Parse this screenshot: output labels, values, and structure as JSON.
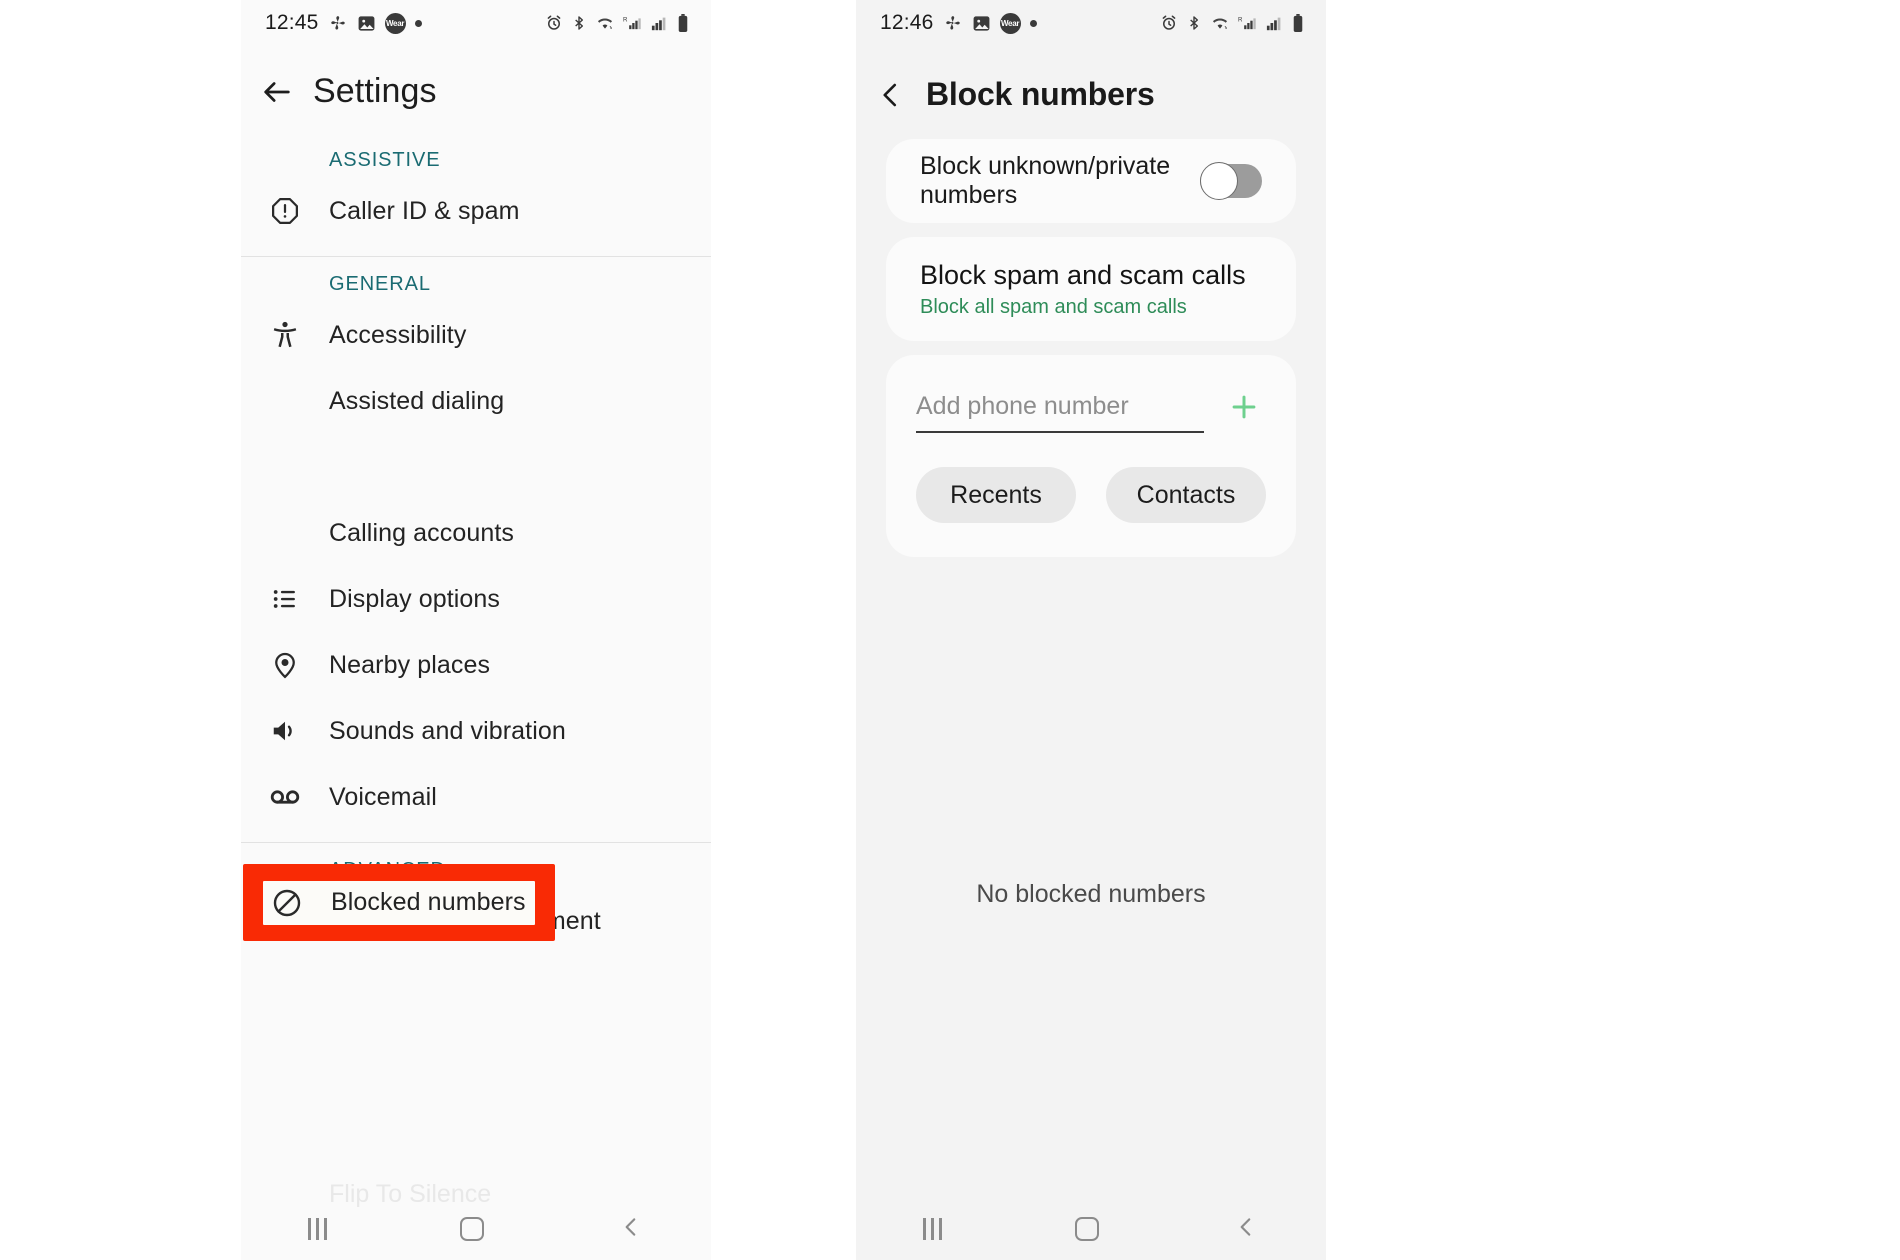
{
  "left_phone": {
    "status_bar": {
      "time": "12:45",
      "icons_left": [
        "fan-icon",
        "image-icon",
        "wear-icon",
        "dot-icon"
      ],
      "wear_label": "Wear",
      "icons_right": [
        "alarm-icon",
        "bluetooth-icon",
        "wifi-icon",
        "signal-r-icon",
        "signal-icon",
        "battery-icon"
      ],
      "signal_r_label": "R"
    },
    "app_bar": {
      "back_icon": "arrow-left-icon",
      "title": "Settings"
    },
    "sections": [
      {
        "label": "ASSISTIVE",
        "items": [
          {
            "icon": "exclamation-octagon-icon",
            "label": "Caller ID & spam"
          }
        ]
      },
      {
        "label": "GENERAL",
        "items": [
          {
            "icon": "accessibility-icon",
            "label": "Accessibility"
          },
          {
            "icon": "none",
            "label": "Assisted dialing"
          },
          {
            "icon": "block-icon",
            "label": "Blocked numbers",
            "highlighted": true
          },
          {
            "icon": "none",
            "label": "Calling accounts"
          },
          {
            "icon": "list-icon",
            "label": "Display options"
          },
          {
            "icon": "location-pin-icon",
            "label": "Nearby places"
          },
          {
            "icon": "speaker-icon",
            "label": "Sounds and vibration"
          },
          {
            "icon": "voicemail-icon",
            "label": "Voicemail"
          }
        ]
      },
      {
        "label": "ADVANCED",
        "items": [
          {
            "icon": "none",
            "label": "Caller ID announcement"
          }
        ]
      }
    ],
    "faded_item": "Flip To Silence",
    "highlight_color": "#f92a05",
    "section_label_color": "#1a6b72",
    "nav_bar": {
      "recents_icon": "recents-icon",
      "home_icon": "home-icon",
      "back_icon": "chevron-left-icon"
    }
  },
  "right_phone": {
    "status_bar": {
      "time": "12:46",
      "icons_left": [
        "fan-icon",
        "image-icon",
        "wear-icon",
        "dot-icon"
      ],
      "wear_label": "Wear",
      "icons_right": [
        "alarm-icon",
        "bluetooth-icon",
        "wifi-icon",
        "signal-r-icon",
        "signal-icon",
        "battery-icon"
      ],
      "signal_r_label": "R"
    },
    "app_bar": {
      "back_icon": "chevron-left-icon",
      "title": "Block numbers"
    },
    "block_unknown": {
      "label": "Block unknown/private numbers",
      "toggle_on": false
    },
    "block_spam": {
      "title": "Block spam and scam calls",
      "subtitle": "Block all spam and scam calls",
      "subtitle_color": "#2e8c58"
    },
    "add_number": {
      "placeholder": "Add phone number",
      "value": "",
      "plus_icon": "plus-icon",
      "plus_color": "#6ed08e"
    },
    "chips": [
      {
        "label": "Recents"
      },
      {
        "label": "Contacts"
      }
    ],
    "empty_state": "No blocked numbers",
    "nav_bar": {
      "recents_icon": "recents-icon",
      "home_icon": "home-icon",
      "back_icon": "chevron-left-icon"
    }
  }
}
